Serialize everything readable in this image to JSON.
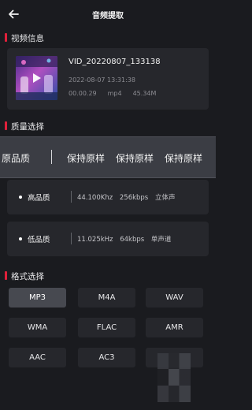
{
  "header": {
    "title": "音频提取"
  },
  "video_section": {
    "title": "视频信息"
  },
  "video": {
    "name": "VID_20220807_133138",
    "date": "2022-08-07 13:31:38",
    "duration": "00.00.29",
    "format": "mp4",
    "size": "45.34M"
  },
  "quality_section": {
    "title": "质量选择"
  },
  "quality_picker": {
    "current": "原品质",
    "options": [
      "保持原样",
      "保持原样",
      "保持原样"
    ]
  },
  "quality_options": [
    {
      "name": "高品质",
      "sample_rate": "44.100Khz",
      "bitrate": "256kbps",
      "channels": "立体声"
    },
    {
      "name": "低品质",
      "sample_rate": "11.025kHz",
      "bitrate": "64kbps",
      "channels": "单声道"
    }
  ],
  "format_section": {
    "title": "格式选择"
  },
  "formats": [
    "MP3",
    "M4A",
    "WAV",
    "WMA",
    "FLAC",
    "AMR",
    "AAC",
    "AC3",
    ""
  ],
  "selected_format": "MP3",
  "colors": {
    "accent": "#e0203a",
    "background": "#1a1b1f",
    "card": "#26272c"
  }
}
